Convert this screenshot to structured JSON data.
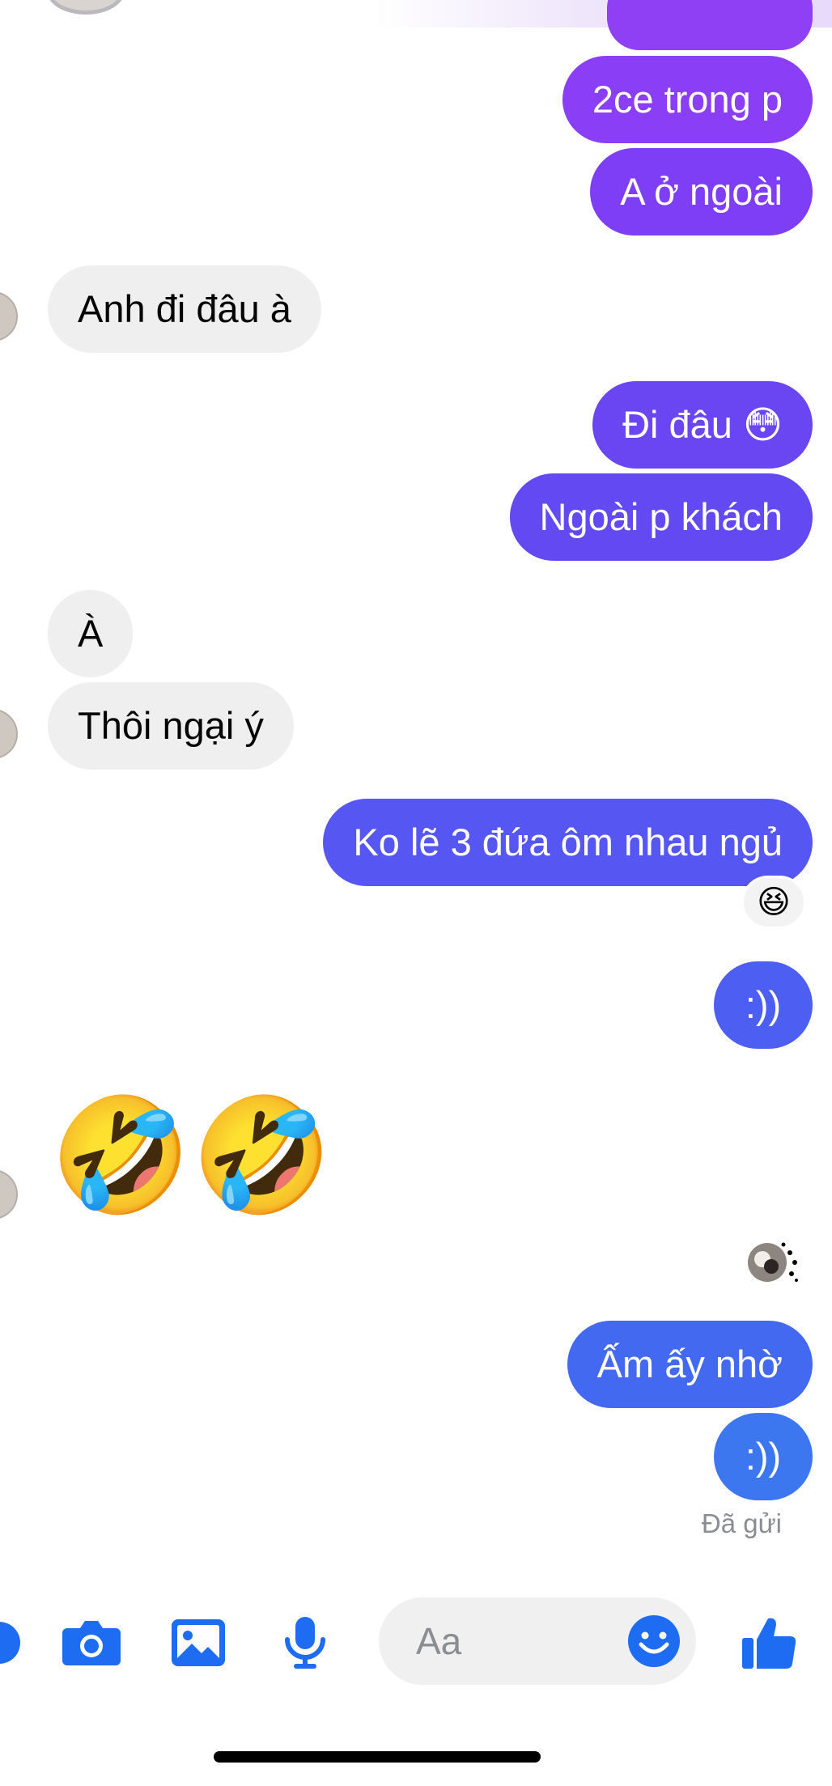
{
  "colors": {
    "outgoing_purple": "#8a3ff6",
    "outgoing_violet": "#6a45f2",
    "outgoing_indigo": "#5657f3",
    "outgoing_blue": "#4369f0",
    "outgoing_lightblue": "#3d77ef",
    "incoming": "#efefef",
    "composer_icons": "#1e6cf1"
  },
  "messages": {
    "m1": "2ce trong p",
    "m2": "A ở ngoài",
    "m3": "Anh đi đâu à",
    "m4": "Đi đâu 😳",
    "m5": "Ngoài p khách",
    "m6": "À",
    "m7": "Thôi ngại ý",
    "m8": "Ko lẽ 3 đứa ôm nhau ngủ",
    "m8_reaction": "😆",
    "m9": ":))",
    "m10": "🤣🤣",
    "m11": "Ấm ấy nhờ",
    "m12": ":))"
  },
  "status": {
    "sent": "Đã gửi"
  },
  "composer": {
    "placeholder": "Aa",
    "icons": [
      "more-icon",
      "camera-icon",
      "image-icon",
      "microphone-icon",
      "emoji-icon",
      "like-icon"
    ]
  }
}
